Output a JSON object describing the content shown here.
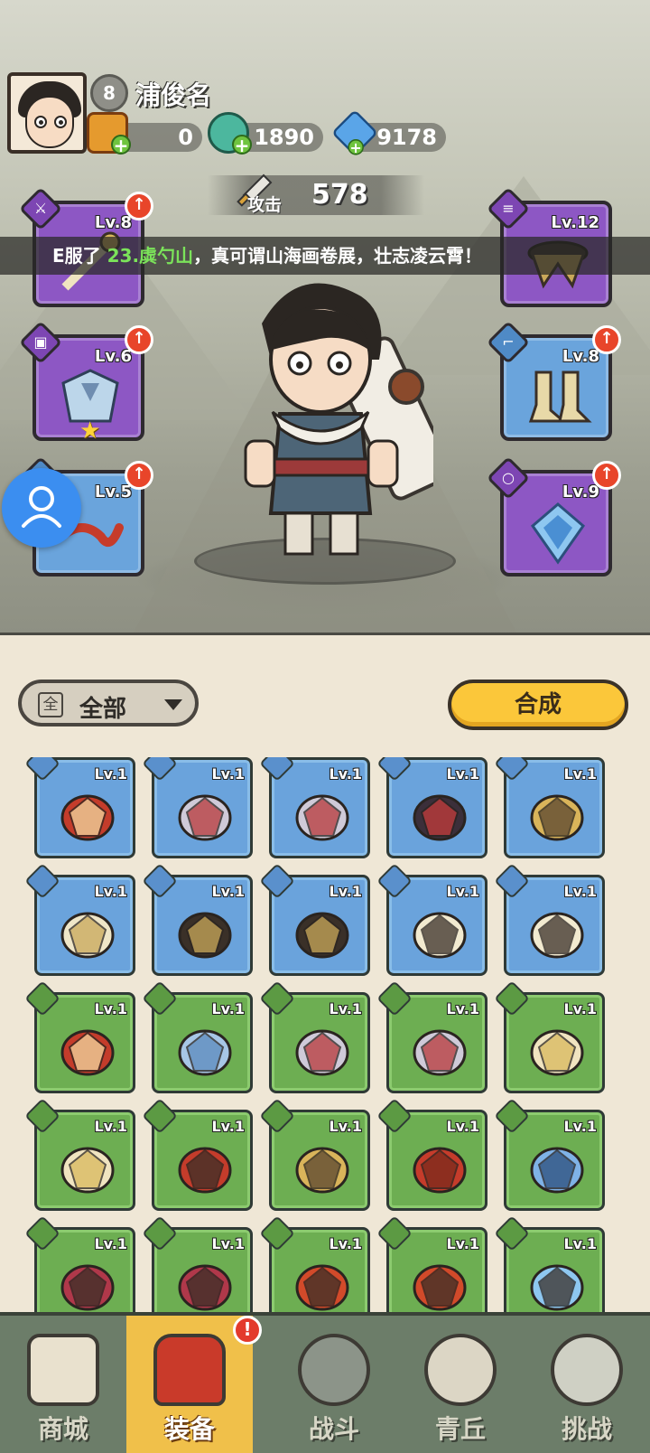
{
  "player": {
    "level": "8",
    "name": "浦俊名"
  },
  "currencies": [
    {
      "name": "scroll-ticket",
      "value": "0"
    },
    {
      "name": "jade-dragon",
      "value": "1890"
    },
    {
      "name": "blue-crystal",
      "value": "9178"
    }
  ],
  "attack": {
    "label": "攻击",
    "value": "578"
  },
  "marquee": {
    "prefix": "E服了 ",
    "highlight": "23.虡勺山",
    "suffix": "，真可谓山海画卷展，壮志凌云霄！"
  },
  "equipped": {
    "left": [
      {
        "level": "Lv.8",
        "rarity": "purple",
        "type": "sword",
        "upgrade": true
      },
      {
        "level": "Lv.6",
        "rarity": "purple",
        "type": "armor",
        "upgrade": true,
        "star": true
      },
      {
        "level": "Lv.5",
        "rarity": "blue",
        "type": "bracer",
        "upgrade": true
      }
    ],
    "right": [
      {
        "level": "Lv.12",
        "rarity": "purple",
        "type": "belt",
        "upgrade": false
      },
      {
        "level": "Lv.8",
        "rarity": "blue",
        "type": "boots",
        "upgrade": true
      },
      {
        "level": "Lv.9",
        "rarity": "purple",
        "type": "amulet",
        "upgrade": true
      }
    ]
  },
  "filter": {
    "icon_text": "全",
    "label": "全部"
  },
  "compose_button": "合成",
  "inventory": [
    [
      {
        "rarity": "blue",
        "level": "Lv.1",
        "item": "flame-bow"
      },
      {
        "rarity": "blue",
        "level": "Lv.1",
        "item": "anvil-blade"
      },
      {
        "rarity": "blue",
        "level": "Lv.1",
        "item": "anvil-blade"
      },
      {
        "rarity": "blue",
        "level": "Lv.1",
        "item": "dark-armor"
      },
      {
        "rarity": "blue",
        "level": "Lv.1",
        "item": "golden-armor"
      }
    ],
    [
      {
        "rarity": "blue",
        "level": "Lv.1",
        "item": "feather-bracer"
      },
      {
        "rarity": "blue",
        "level": "Lv.1",
        "item": "horned-belt"
      },
      {
        "rarity": "blue",
        "level": "Lv.1",
        "item": "horned-belt"
      },
      {
        "rarity": "blue",
        "level": "Lv.1",
        "item": "fang-necklace"
      },
      {
        "rarity": "blue",
        "level": "Lv.1",
        "item": "fang-necklace"
      }
    ],
    [
      {
        "rarity": "green",
        "level": "Lv.1",
        "item": "flame-bow"
      },
      {
        "rarity": "green",
        "level": "Lv.1",
        "item": "crossbow"
      },
      {
        "rarity": "green",
        "level": "Lv.1",
        "item": "anvil-blade"
      },
      {
        "rarity": "green",
        "level": "Lv.1",
        "item": "anvil-blade"
      },
      {
        "rarity": "green",
        "level": "Lv.1",
        "item": "golden-staff"
      }
    ],
    [
      {
        "rarity": "green",
        "level": "Lv.1",
        "item": "golden-staff"
      },
      {
        "rarity": "green",
        "level": "Lv.1",
        "item": "red-armor"
      },
      {
        "rarity": "green",
        "level": "Lv.1",
        "item": "golden-armor"
      },
      {
        "rarity": "green",
        "level": "Lv.1",
        "item": "crimson-bracer"
      },
      {
        "rarity": "green",
        "level": "Lv.1",
        "item": "ice-bracer"
      }
    ],
    [
      {
        "rarity": "green",
        "level": "Lv.1",
        "item": "thorn-bracer"
      },
      {
        "rarity": "green",
        "level": "Lv.1",
        "item": "thorn-bracer"
      },
      {
        "rarity": "green",
        "level": "Lv.1",
        "item": "fire-belt"
      },
      {
        "rarity": "green",
        "level": "Lv.1",
        "item": "fire-belt"
      },
      {
        "rarity": "green",
        "level": "Lv.1",
        "item": "ice-belt"
      }
    ]
  ],
  "nav": [
    {
      "label": "商城",
      "icon": "shop-icon",
      "active": false
    },
    {
      "label": "装备",
      "icon": "equipment-icon",
      "active": true,
      "badge": "!"
    },
    {
      "label": "战斗",
      "icon": "battle-icon",
      "active": false
    },
    {
      "label": "青丘",
      "icon": "qingqiu-icon",
      "active": false
    },
    {
      "label": "挑战",
      "icon": "challenge-icon",
      "active": false
    }
  ],
  "colors": {
    "purple": "#8d57c4",
    "blue": "#6aa3dc",
    "green": "#6dae52",
    "accent_yellow": "#fbc73a",
    "upgrade_red": "#e8452a",
    "highlight_green": "#7be35a"
  }
}
